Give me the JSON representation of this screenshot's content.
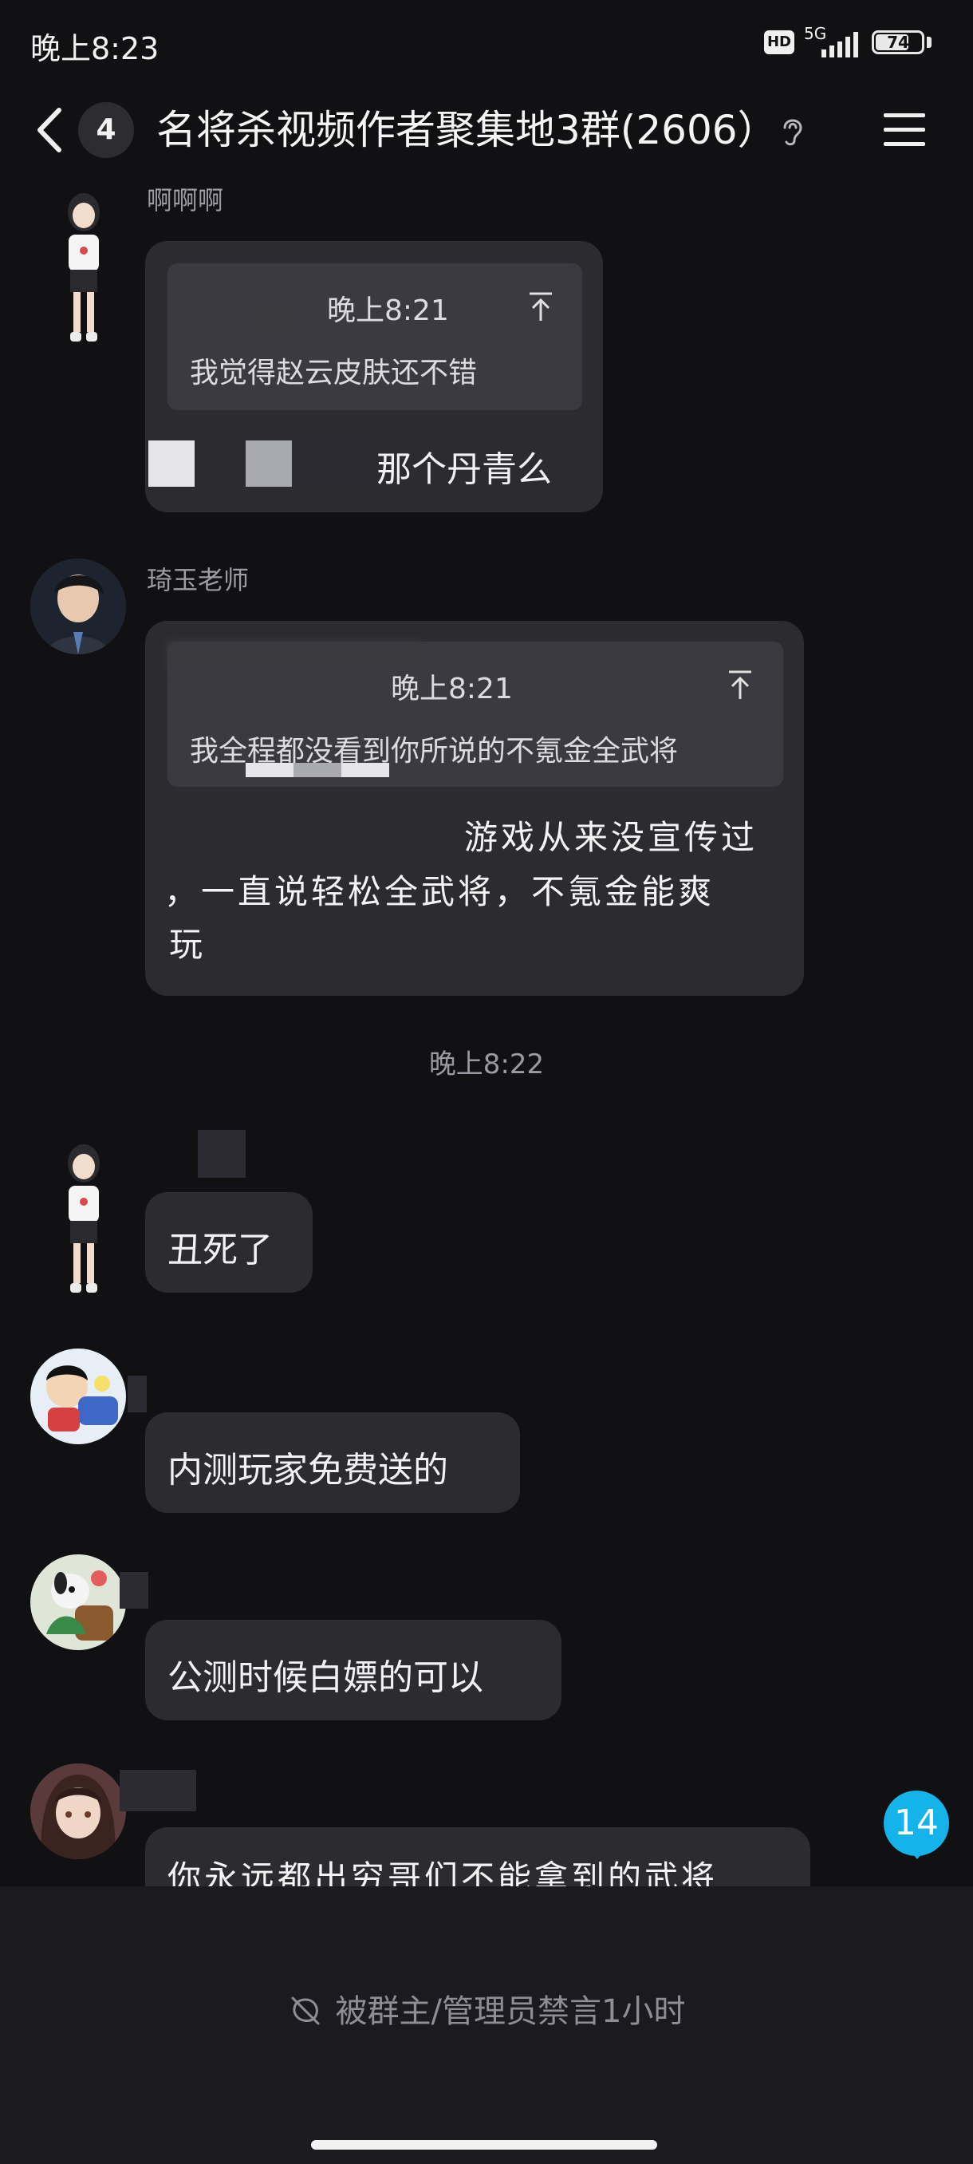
{
  "status_bar": {
    "time": "晚上8:23",
    "hd": "HD",
    "network": "5G",
    "battery": "74",
    "battery_level": 0.74
  },
  "header": {
    "back_count": "4",
    "title": "名将杀视频作者聚集地3群(2606）"
  },
  "messages": [
    {
      "sender": "啊啊啊",
      "quote": {
        "time": "晚上8:21",
        "text": "我觉得赵云皮肤还不错"
      },
      "text": "那个丹青么"
    },
    {
      "sender": "琦玉老师",
      "quote": {
        "time": "晚上8:21",
        "text": "我全程都没看到你所说的不氪金全武将"
      },
      "lines": [
        "游戏从来没宣传过",
        "，一直说轻松全武将，不氪金能爽",
        "玩"
      ]
    },
    {
      "text": "丑死了"
    },
    {
      "text": "内测玩家免费送的"
    },
    {
      "text": "公测时候白嫖的可以"
    },
    {
      "text": "你永远都出穷哥们不能拿到的武将"
    }
  ],
  "time_separator": "晚上8:22",
  "new_message_count": "14",
  "bottom": {
    "mute_notice": "被群主/管理员禁言1小时"
  }
}
